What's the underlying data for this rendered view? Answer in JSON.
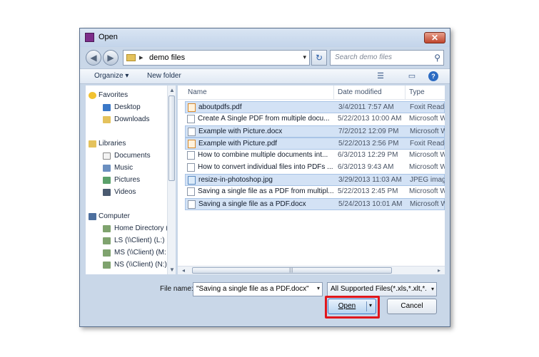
{
  "window": {
    "title": "Open",
    "close_glyph": "✕"
  },
  "address": {
    "back_glyph": "◀",
    "forward_glyph": "▶",
    "separator": "▸",
    "path": "demo files",
    "dropdown_glyph": "▾",
    "refresh_glyph": "↻",
    "search_placeholder": "Search demo files",
    "search_glyph": "⚲"
  },
  "toolbar": {
    "organize_label": "Organize ▾",
    "new_folder_label": "New folder",
    "views_glyph": "☰",
    "preview_glyph": "▭",
    "help_glyph": "?"
  },
  "navigation": {
    "items": [
      {
        "label": "Favorites",
        "icon": "star-icon"
      },
      {
        "label": "Desktop",
        "icon": "desktop-icon"
      },
      {
        "label": "Downloads",
        "icon": "downloads-icon"
      },
      {
        "label": "Libraries",
        "icon": "library-icon"
      },
      {
        "label": "Documents",
        "icon": "documents-icon"
      },
      {
        "label": "Music",
        "icon": "music-icon"
      },
      {
        "label": "Pictures",
        "icon": "pictures-icon"
      },
      {
        "label": "Videos",
        "icon": "videos-icon"
      },
      {
        "label": "Computer",
        "icon": "computer-icon"
      },
      {
        "label": "Home Directory (",
        "icon": "network-drive-icon"
      },
      {
        "label": "LS (\\\\Client) (L:)",
        "icon": "network-drive-icon"
      },
      {
        "label": "MS (\\\\Client) (M:",
        "icon": "network-drive-icon"
      },
      {
        "label": "NS (\\\\Client) (N:)",
        "icon": "network-drive-icon"
      }
    ]
  },
  "columns": {
    "name": "Name",
    "date": "Date modified",
    "type": "Type"
  },
  "files": [
    {
      "name": "aboutpdfs.pdf",
      "date": "3/4/2011 7:57 AM",
      "type": "Foxit Reader",
      "kind": "pdf",
      "selected": true
    },
    {
      "name": "Create A Single PDF from multiple docu...",
      "date": "5/22/2013 10:00 AM",
      "type": "Microsoft W",
      "kind": "doc",
      "selected": false
    },
    {
      "name": "Example with Picture.docx",
      "date": "7/2/2012 12:09 PM",
      "type": "Microsoft W",
      "kind": "doc",
      "selected": true
    },
    {
      "name": "Example with Picture.pdf",
      "date": "5/22/2013 2:56 PM",
      "type": "Foxit Reader",
      "kind": "pdf",
      "selected": true
    },
    {
      "name": "How to combine multiple documents int...",
      "date": "6/3/2013 12:29 PM",
      "type": "Microsoft W",
      "kind": "doc",
      "selected": false
    },
    {
      "name": "How to convert individual files into PDFs ...",
      "date": "6/3/2013 9:43 AM",
      "type": "Microsoft W",
      "kind": "doc",
      "selected": false
    },
    {
      "name": "resize-in-photoshop.jpg",
      "date": "3/29/2013 11:03 AM",
      "type": "JPEG image",
      "kind": "jpg",
      "selected": true
    },
    {
      "name": "Saving a single file as a PDF from multipl...",
      "date": "5/22/2013 2:45 PM",
      "type": "Microsoft W",
      "kind": "doc",
      "selected": false
    },
    {
      "name": "Saving a single file as a PDF.docx",
      "date": "5/24/2013 10:01 AM",
      "type": "Microsoft W",
      "kind": "doc",
      "selected": true
    }
  ],
  "footer": {
    "file_name_label": "File name:",
    "file_name_value": "\"Saving a single file as a PDF.docx\" \"a",
    "filter_value": "All Supported Files(*.xls,*.xlt,*.xl",
    "open_label": "Open",
    "cancel_label": "Cancel",
    "dropdown_glyph": "▾"
  },
  "colors": {
    "accent": "#3d7bc7",
    "highlight": "#e0161c",
    "selection": "#d3e2f5"
  }
}
